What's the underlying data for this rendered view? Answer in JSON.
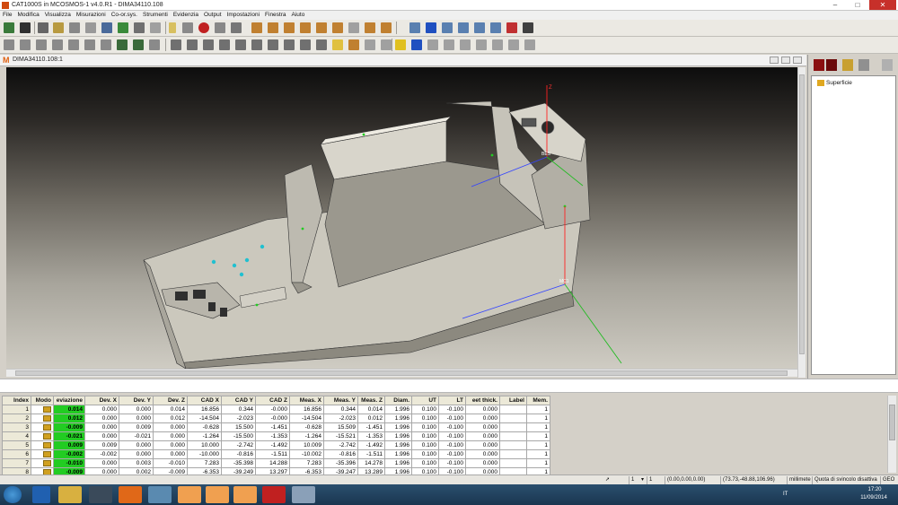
{
  "window": {
    "title": "CAT1000S in MCOSMOS-1 v4.0.R1 - DIMA34110.108",
    "minimize": "–",
    "maximize": "□",
    "close": "✕"
  },
  "menu": [
    "File",
    "Modifica",
    "Visualizza",
    "Misurazioni",
    "Co-or.sys.",
    "Strumenti",
    "Evidenzia",
    "Output",
    "Impostazioni",
    "Finestra",
    "Aiuto"
  ],
  "document": {
    "icon_letter": "M",
    "title": "DIMA34110.108:1"
  },
  "viewport": {
    "axis_labels": {
      "z_top": "Z",
      "bes": "BES",
      "mc": "MC1"
    }
  },
  "tree": {
    "items": [
      {
        "label": "Superficie",
        "icon": "surface-icon"
      }
    ]
  },
  "table": {
    "columns": [
      "Index",
      "Modo",
      "eviazione",
      "Dev. X",
      "Dev. Y",
      "Dev. Z",
      "CAD X",
      "CAD Y",
      "CAD Z",
      "Meas. X",
      "Meas. Y",
      "Meas. Z",
      "Diam.",
      "UT",
      "LT",
      "eet thick.",
      "Label",
      "Mem."
    ],
    "rows": [
      [
        "1",
        "",
        "0.014",
        "0.000",
        "0.000",
        "0.014",
        "16.856",
        "0.344",
        "-0.000",
        "16.856",
        "0.344",
        "0.014",
        "1.996",
        "0.100",
        "-0.100",
        "0.000",
        "",
        "1"
      ],
      [
        "2",
        "",
        "0.012",
        "0.000",
        "0.000",
        "0.012",
        "-14.504",
        "-2.023",
        "-0.000",
        "-14.504",
        "-2.023",
        "0.012",
        "1.996",
        "0.100",
        "-0.100",
        "0.000",
        "",
        "1"
      ],
      [
        "3",
        "",
        "-0.009",
        "0.000",
        "0.009",
        "0.000",
        "-0.628",
        "15.500",
        "-1.451",
        "-0.628",
        "15.509",
        "-1.451",
        "1.996",
        "0.100",
        "-0.100",
        "0.000",
        "",
        "1"
      ],
      [
        "4",
        "",
        "-0.021",
        "0.000",
        "-0.021",
        "0.000",
        "-1.264",
        "-15.500",
        "-1.353",
        "-1.264",
        "-15.521",
        "-1.353",
        "1.996",
        "0.100",
        "-0.100",
        "0.000",
        "",
        "1"
      ],
      [
        "5",
        "",
        "0.009",
        "0.009",
        "0.000",
        "0.000",
        "10.000",
        "-2.742",
        "-1.492",
        "10.009",
        "-2.742",
        "-1.492",
        "1.996",
        "0.100",
        "-0.100",
        "0.000",
        "",
        "1"
      ],
      [
        "6",
        "",
        "-0.002",
        "-0.002",
        "0.000",
        "0.000",
        "-10.000",
        "-0.816",
        "-1.511",
        "-10.002",
        "-0.816",
        "-1.511",
        "1.996",
        "0.100",
        "-0.100",
        "0.000",
        "",
        "1"
      ],
      [
        "7",
        "",
        "-0.010",
        "0.000",
        "0.003",
        "-0.010",
        "7.283",
        "-35.398",
        "14.288",
        "7.283",
        "-35.396",
        "14.278",
        "1.996",
        "0.100",
        "-0.100",
        "0.000",
        "",
        "1"
      ],
      [
        "8",
        "",
        "-0.009",
        "0.000",
        "0.002",
        "-0.009",
        "-6.353",
        "-39.249",
        "13.297",
        "-6.353",
        "-39.247",
        "13.289",
        "1.996",
        "0.100",
        "-0.100",
        "0.000",
        "",
        "1"
      ]
    ]
  },
  "statusbar": {
    "n1": "1",
    "n2": "1",
    "origin": "(0.00,0.00,0.00)",
    "coords": "(73.73,-48.88,106.96)",
    "unit": "millimete",
    "mode": "Quota di svincolo disattiva",
    "geo": "GEO"
  },
  "taskbar": {
    "lang": "IT",
    "time": "17:20",
    "date": "11/09/2014",
    "apps": [
      "start-button",
      "ie-icon",
      "folder-icon",
      "media-icon",
      "firefox-icon",
      "mcosmos-thumb-icon",
      "mcosmos-icon",
      "mcosmos-icon",
      "mcosmos-icon",
      "pdf-icon",
      "cam-icon"
    ]
  },
  "colors": {
    "deviation_ok": "#22cc22",
    "axis_x": "#3344ff",
    "axis_y": "#22bb22",
    "axis_z": "#ff2222",
    "app_accent": "#e06010"
  }
}
